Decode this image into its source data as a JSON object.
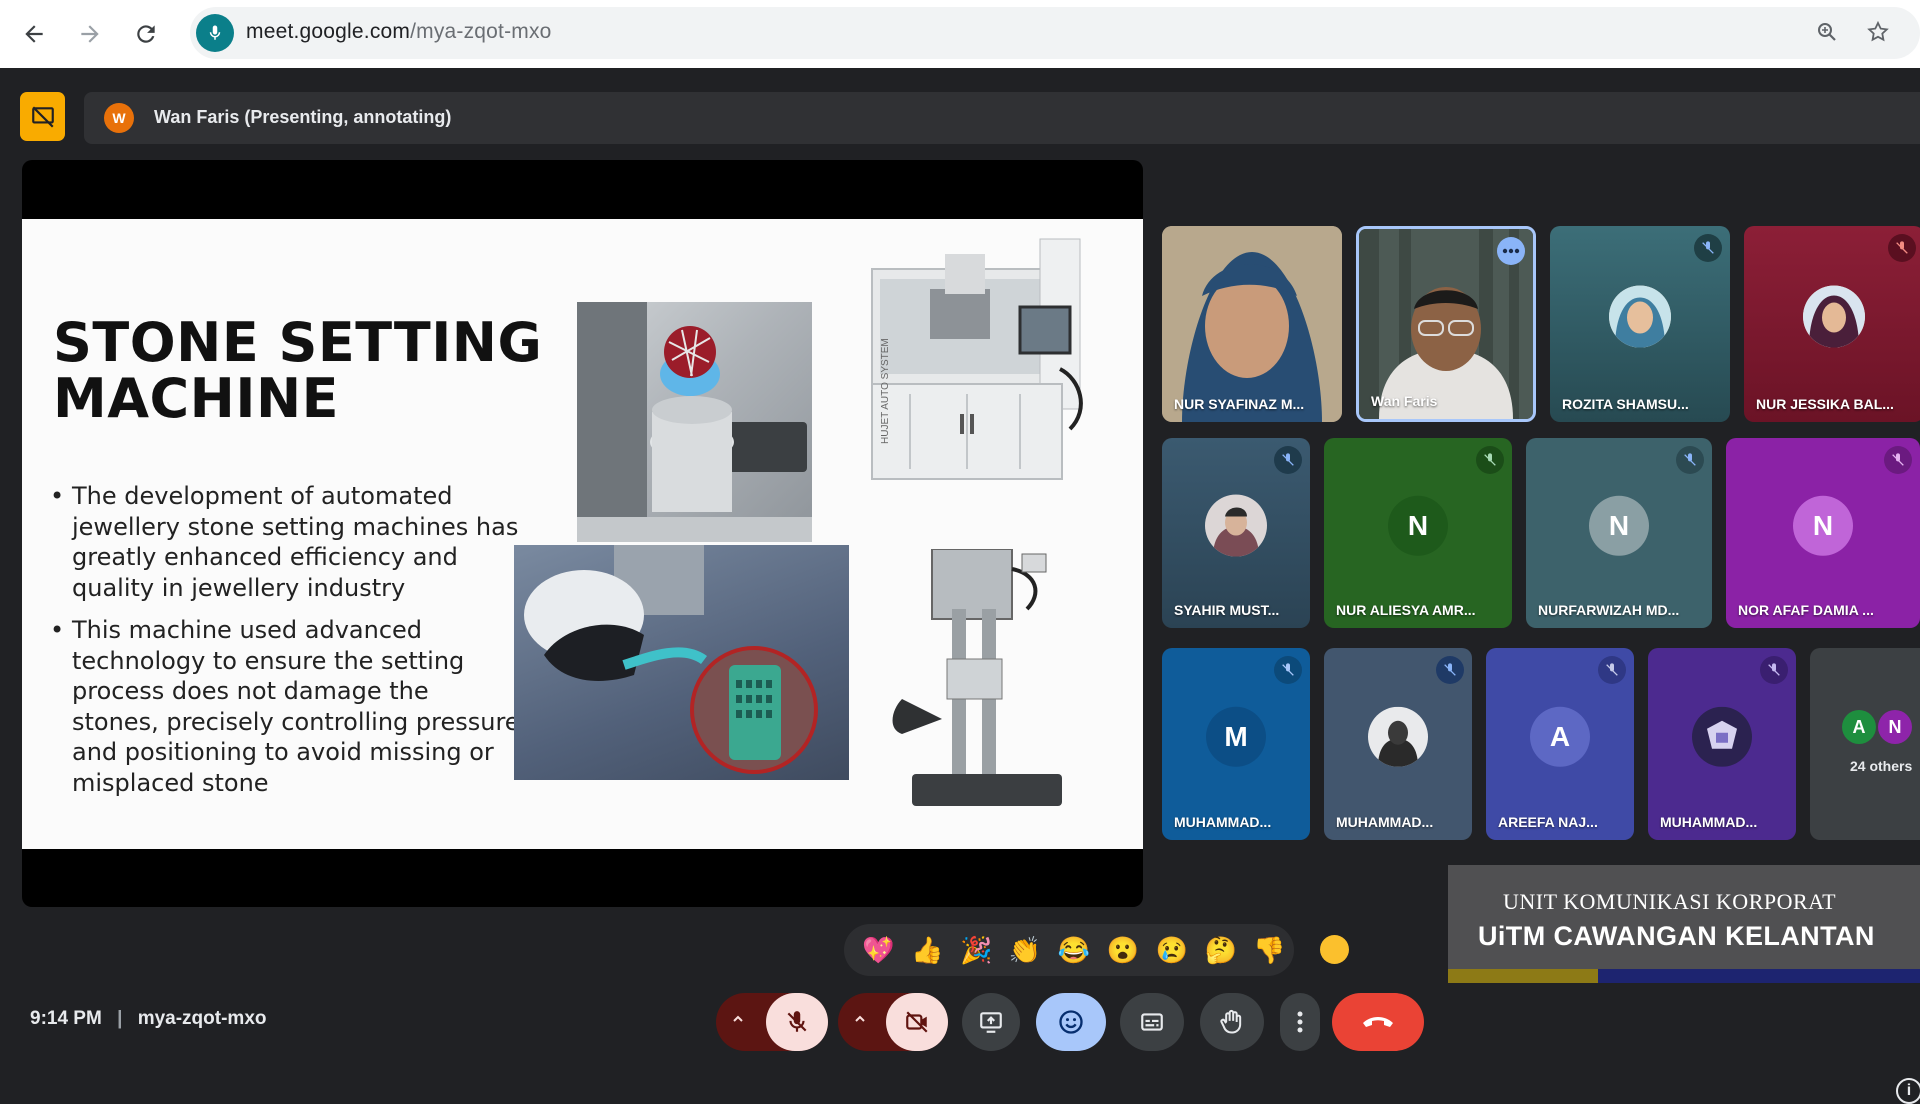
{
  "browser": {
    "url_host": "meet.google.com",
    "url_path": "/mya-zqot-mxo"
  },
  "meet": {
    "presenter_label": "Wan Faris (Presenting, annotating)",
    "presenter_initial": "W",
    "time": "9:14 PM",
    "separator": "|",
    "meeting_code": "mya-zqot-mxo"
  },
  "slide": {
    "title_line1": "STONE SETTING",
    "title_line2": "MACHINE",
    "bullets": [
      "The development of automated jewellery stone setting machines has greatly enhanced efficiency and quality in jewellery industry",
      "This machine used advanced technology to ensure the setting process does not damage the stones, precisely controlling pressure and positioning to avoid missing or misplaced stone"
    ],
    "machine_side_label": "HUJET AUTO SYSTEM"
  },
  "participants": [
    {
      "name": "NUR SYAFINAZ M...",
      "type": "video",
      "muted": false
    },
    {
      "name": "Wan Faris",
      "type": "video",
      "muted": false,
      "speaking": true
    },
    {
      "name": "ROZITA SHAMSU...",
      "type": "photo",
      "muted": true
    },
    {
      "name": "NUR JESSIKA BAL...",
      "type": "photo",
      "muted": true
    },
    {
      "name": "SYAHIR MUST...",
      "type": "photo",
      "muted": true
    },
    {
      "name": "NUR ALIESYA AMR...",
      "type": "letter",
      "initial": "N",
      "muted": true
    },
    {
      "name": "NURFARWIZAH MD...",
      "type": "letter",
      "initial": "N",
      "muted": true
    },
    {
      "name": "NOR AFAF DAMIA ...",
      "type": "letter",
      "initial": "N",
      "muted": true
    },
    {
      "name": "MUHAMMAD...",
      "type": "letter",
      "initial": "M",
      "muted": true
    },
    {
      "name": "MUHAMMAD...",
      "type": "photo",
      "muted": true
    },
    {
      "name": "AREEFA NAJ...",
      "type": "letter",
      "initial": "A",
      "muted": true
    },
    {
      "name": "MUHAMMAD...",
      "type": "photo",
      "muted": true
    }
  ],
  "others": {
    "initials": [
      "A",
      "N"
    ],
    "label": "24 others"
  },
  "reactions": [
    "💖",
    "👍",
    "🎉",
    "👏",
    "😂",
    "😮",
    "😢",
    "🤔",
    "👎"
  ],
  "watermark": {
    "line1": "UNIT KOMUNIKASI KORPORAT",
    "line2": "UiTM CAWANGAN KELANTAN"
  },
  "icons": [
    "back-icon",
    "forward-icon",
    "reload-icon",
    "site-mic-icon",
    "zoom-icon",
    "star-icon",
    "presentation-icon",
    "mic-off-icon",
    "camera-off-icon",
    "present-screen-icon",
    "emoji-icon",
    "captions-icon",
    "raise-hand-icon",
    "more-options-icon",
    "hang-up-icon",
    "info-icon"
  ],
  "colors": {
    "meet_bg": "#202124",
    "presenting_chip": "#f9ab00",
    "hangup": "#ea4335",
    "reactions_active": "#a8c7fa"
  }
}
